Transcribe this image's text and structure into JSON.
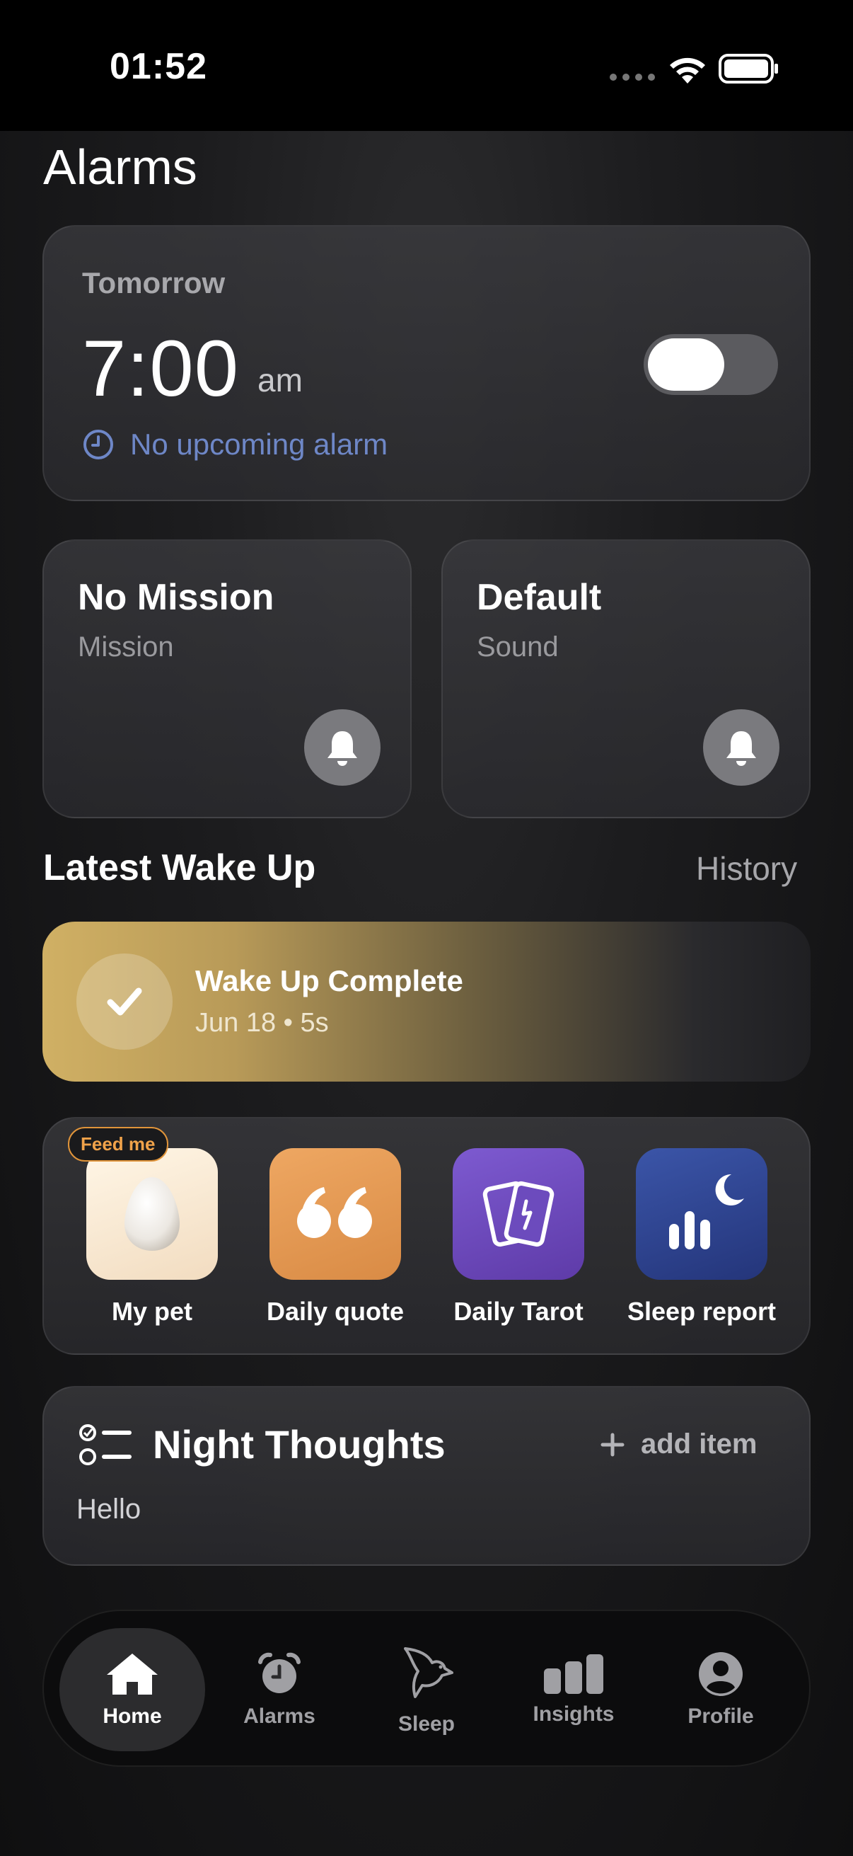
{
  "status_bar": {
    "time": "01:52"
  },
  "page": {
    "title": "Alarms"
  },
  "alarm": {
    "day": "Tomorrow",
    "time": "7:00",
    "ampm": "am",
    "enabled": true,
    "status": "No upcoming alarm"
  },
  "mission": {
    "title": "No Mission",
    "subtitle": "Mission"
  },
  "sound": {
    "title": "Default",
    "subtitle": "Sound"
  },
  "latest": {
    "section_title": "Latest Wake Up",
    "history_label": "History",
    "card_title": "Wake Up Complete",
    "card_sub": "Jun 18 • 5s"
  },
  "apps": [
    {
      "label": "My pet",
      "badge": "Feed me",
      "icon": "egg-icon"
    },
    {
      "label": "Daily quote",
      "icon": "quote-icon"
    },
    {
      "label": "Daily Tarot",
      "icon": "tarot-cards-icon"
    },
    {
      "label": "Sleep report",
      "icon": "sleep-report-icon"
    }
  ],
  "thoughts": {
    "title": "Night Thoughts",
    "add_label": "add item",
    "body": "Hello"
  },
  "tabs": [
    {
      "label": "Home",
      "icon": "home-icon",
      "active": true
    },
    {
      "label": "Alarms",
      "icon": "alarm-clock-icon",
      "active": false
    },
    {
      "label": "Sleep",
      "icon": "bird-icon",
      "active": false
    },
    {
      "label": "Insights",
      "icon": "bar-chart-icon",
      "active": false
    },
    {
      "label": "Profile",
      "icon": "profile-icon",
      "active": false
    }
  ],
  "colors": {
    "accent_blue": "#6e87c7",
    "feed_badge": "#e0943a",
    "wake_gradient_start": "#d0b064"
  }
}
